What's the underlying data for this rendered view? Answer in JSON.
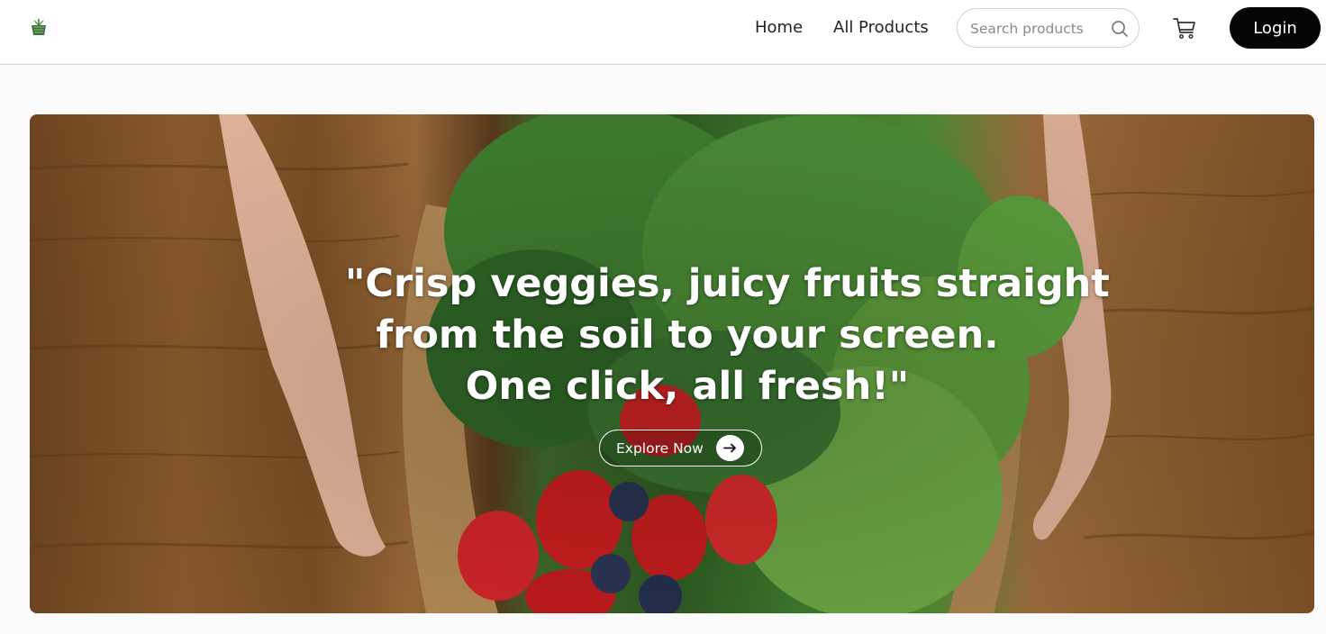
{
  "header": {
    "logo_icon": "vegetable-basket-logo-icon",
    "nav": [
      {
        "label": "Home"
      },
      {
        "label": "All Products"
      }
    ],
    "search": {
      "placeholder": "Search products",
      "value": "",
      "icon": "search-icon"
    },
    "cart_icon": "cart-icon",
    "login_label": "Login"
  },
  "hero": {
    "headline_lines": [
      "\"Crisp veggies, juicy fruits straight",
      "from the soil to your screen.",
      "One click, all fresh!\""
    ],
    "cta_label": "Explore Now",
    "cta_icon": "arrow-right-icon"
  },
  "colors": {
    "login_bg": "#050505",
    "text_primary": "#222222",
    "hero_text": "#ffffff"
  }
}
